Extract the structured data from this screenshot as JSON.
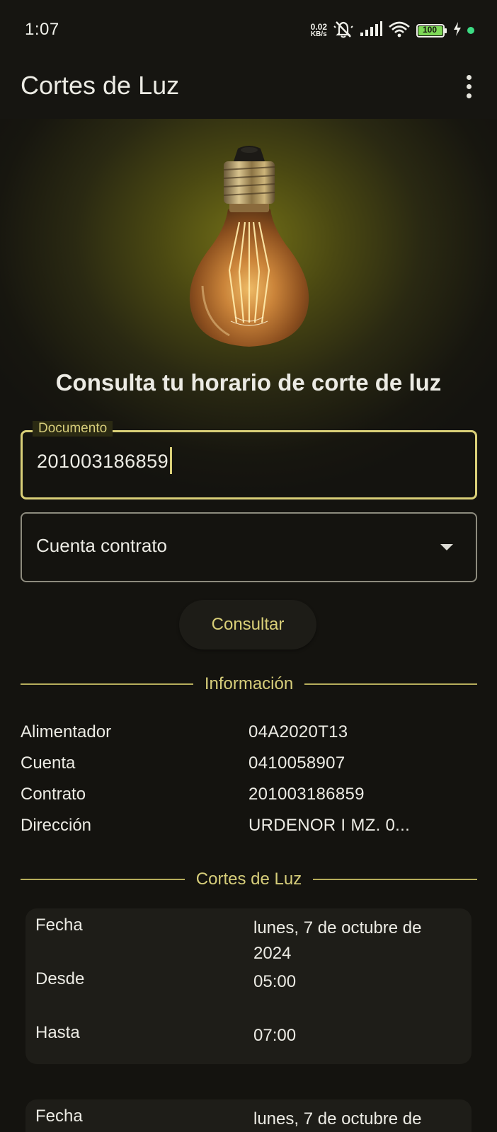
{
  "status_bar": {
    "time": "1:07",
    "net_speed_value": "0.02",
    "net_speed_unit": "KB/s",
    "battery": "100",
    "icons": [
      "mute-icon",
      "signal-icon",
      "wifi-icon",
      "battery-icon",
      "charging-icon",
      "dot-indicator"
    ]
  },
  "app_bar": {
    "title": "Cortes de Luz",
    "menu_icon": "more-vert-icon"
  },
  "main": {
    "headline": "Consulta tu horario de corte de luz",
    "documento": {
      "label": "Documento",
      "value": "201003186859"
    },
    "cuenta_contrato": {
      "label": "Cuenta contrato"
    },
    "consult_button": "Consultar"
  },
  "informacion": {
    "title": "Información",
    "rows": [
      {
        "label": "Alimentador",
        "value": "04A2020T13"
      },
      {
        "label": "Cuenta",
        "value": "0410058907"
      },
      {
        "label": "Contrato",
        "value": "201003186859"
      },
      {
        "label": "Dirección",
        "value": "URDENOR I MZ. 0..."
      }
    ]
  },
  "cortes": {
    "title": "Cortes de Luz",
    "cards": [
      {
        "fecha_label": "Fecha",
        "fecha": "lunes, 7 de octubre de 2024",
        "desde_label": "Desde",
        "desde": "05:00",
        "hasta_label": "Hasta",
        "hasta": "07:00"
      },
      {
        "fecha_label": "Fecha",
        "fecha": "lunes, 7 de octubre de"
      }
    ]
  },
  "colors": {
    "accent": "#d9cf78",
    "background": "#14130f",
    "card": "#1e1d18",
    "glow": "#716e17"
  }
}
